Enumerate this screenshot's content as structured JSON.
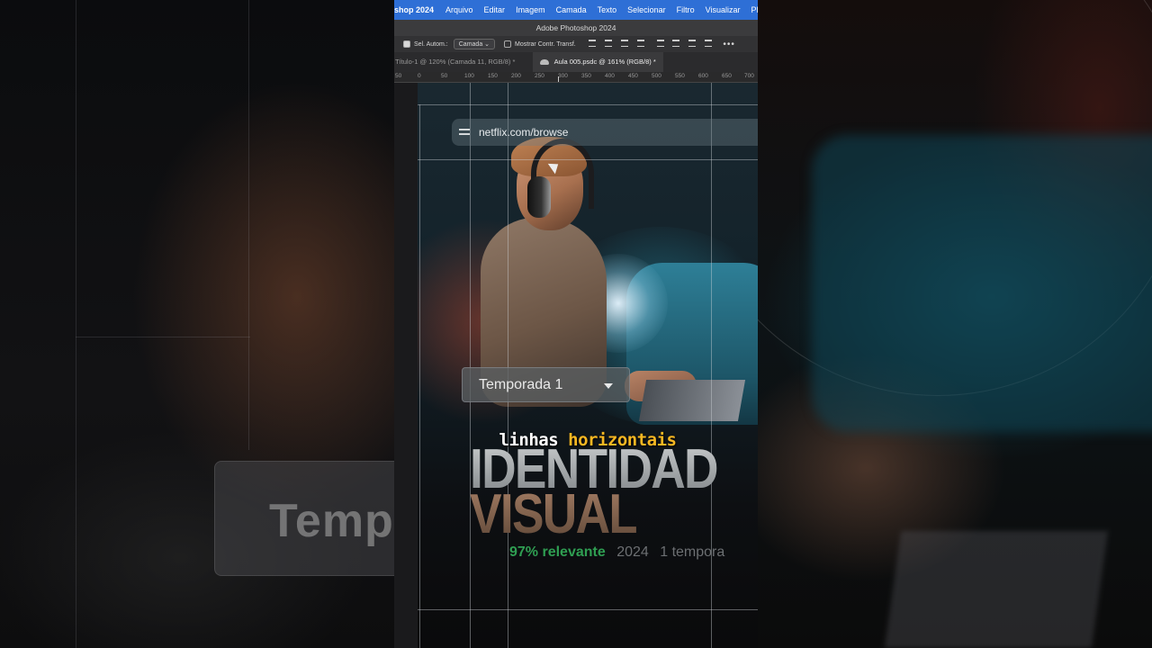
{
  "menubar": {
    "app_name": "shop 2024",
    "items": [
      "Arquivo",
      "Editar",
      "Imagem",
      "Camada",
      "Texto",
      "Selecionar",
      "Filtro",
      "Visualizar",
      "Plu"
    ]
  },
  "window_title": "Adobe Photoshop 2024",
  "options_bar": {
    "auto_select_label": "Sel. Autom.:",
    "auto_select_target": "Camada",
    "show_transform_label": "Mostrar Contr. Transf.",
    "more_label": "•••"
  },
  "tabs": [
    {
      "label": "Título-1 @ 120% (Camada 11, RGB/8) *"
    },
    {
      "label": "Aula 005.psdc @ 161% (RGB/8) *"
    }
  ],
  "ruler_ticks": [
    "50",
    "0",
    "50",
    "100",
    "150",
    "200",
    "250",
    "300",
    "350",
    "400",
    "450",
    "500",
    "550",
    "600",
    "650",
    "700"
  ],
  "canvas": {
    "address_text": "netflix.com/browse",
    "season_selector": "Temporada 1",
    "headline_line1": "IDENTIDAD",
    "headline_line2": "VISUAL",
    "relevance": "97% relevante",
    "year": "2024",
    "seasons": "1 tempora"
  },
  "caption": {
    "word1": "linhas",
    "word2": "horizontais"
  },
  "side_left": {
    "season_ghost": "Temp"
  },
  "colors": {
    "menubar_accent": "#2e6fd6",
    "caption_highlight": "#f6b722",
    "relevance_green": "#2f9e52"
  }
}
